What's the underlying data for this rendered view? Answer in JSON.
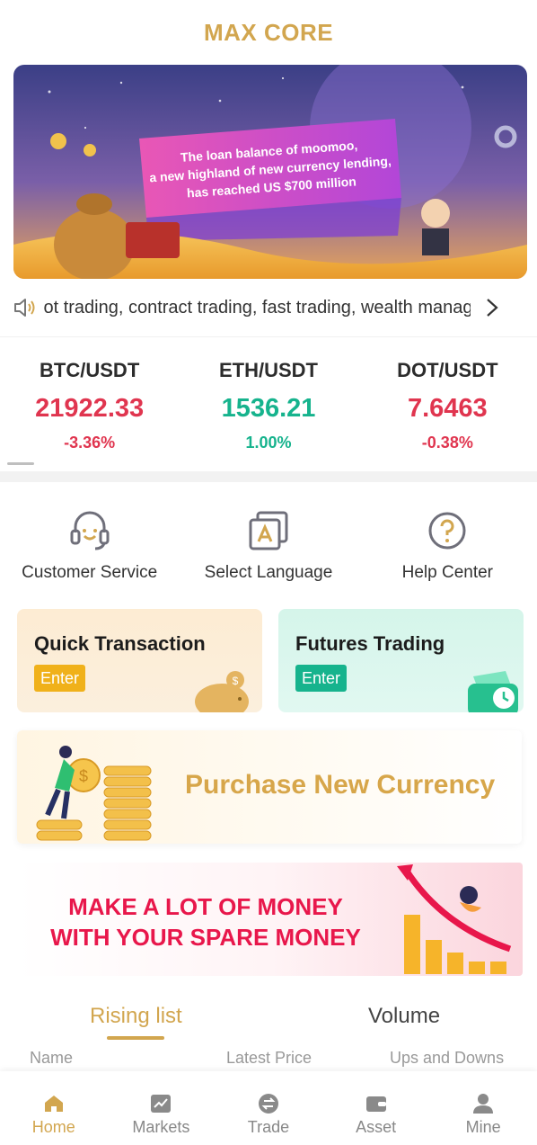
{
  "app": {
    "title": "MAX CORE"
  },
  "banner": {
    "line1": "The loan balance of moomoo,",
    "line2": "a new highland of new currency lending,",
    "line3": "has reached US $700 million"
  },
  "notice": {
    "text": "Spot trading, contract trading, fast trading, wealth management",
    "icon": "speaker-icon"
  },
  "markets": [
    {
      "pair": "BTC/USDT",
      "price": "21922.33",
      "change": "-3.36%",
      "trend": "down"
    },
    {
      "pair": "ETH/USDT",
      "price": "1536.21",
      "change": "1.00%",
      "trend": "up"
    },
    {
      "pair": "DOT/USDT",
      "price": "7.6463",
      "change": "-0.38%",
      "trend": "down"
    }
  ],
  "shortcuts": [
    {
      "label": "Customer Service",
      "icon": "headset-icon"
    },
    {
      "label": "Select Language",
      "icon": "language-icon"
    },
    {
      "label": "Help Center",
      "icon": "help-icon"
    }
  ],
  "cards": {
    "quick": {
      "title": "Quick Transaction",
      "button": "Enter"
    },
    "futures": {
      "title": "Futures Trading",
      "button": "Enter"
    }
  },
  "promo1": {
    "text": "Purchase New Currency"
  },
  "promo2": {
    "line1": "MAKE A LOT OF MONEY",
    "line2": "WITH YOUR SPARE MONEY"
  },
  "list": {
    "tabs": [
      "Rising list",
      "Volume"
    ],
    "active_tab": "Rising list",
    "columns": [
      "Name",
      "Latest Price",
      "Ups and Downs"
    ]
  },
  "tabbar": [
    {
      "label": "Home",
      "icon": "home-icon",
      "active": true
    },
    {
      "label": "Markets",
      "icon": "chart-icon",
      "active": false
    },
    {
      "label": "Trade",
      "icon": "exchange-icon",
      "active": false
    },
    {
      "label": "Asset",
      "icon": "wallet-icon",
      "active": false
    },
    {
      "label": "Mine",
      "icon": "user-icon",
      "active": false
    }
  ],
  "colors": {
    "gold": "#d2a64f",
    "red": "#e0354f",
    "green": "#16b38d",
    "promo_red": "#e8174b"
  }
}
